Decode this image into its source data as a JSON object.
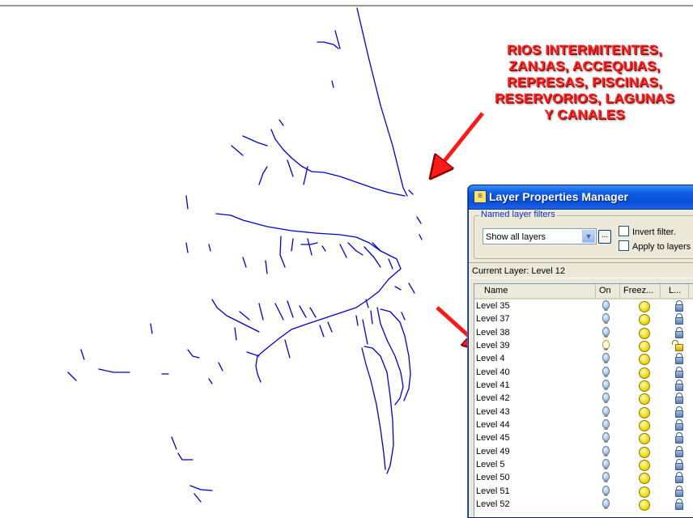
{
  "annotation": {
    "text": "RIOS INTERMITENTES,\nZANJAS, ACCEQUIAS,\nREPRESAS, PISCINAS,\nRESERVORIOS, LAGUNAS\nY CANALES",
    "color": "#ff2020"
  },
  "drawing_line_color": "#0000cc",
  "window": {
    "title": "Layer Properties Manager",
    "icon": "layer-manager-icon",
    "named_filters": {
      "legend": "Named layer filters",
      "selected": "Show all layers"
    },
    "invert_filter_label": "Invert filter.",
    "apply_label": "Apply to layers to",
    "current_layer_label": "Current Layer:",
    "current_layer_value": "Level 12",
    "columns": [
      "Name",
      "On",
      "Freez...",
      "L..."
    ],
    "layers": [
      {
        "name": "Level 35",
        "on": true,
        "frozen": false,
        "locked": true
      },
      {
        "name": "Level 37",
        "on": true,
        "frozen": false,
        "locked": true
      },
      {
        "name": "Level 38",
        "on": true,
        "frozen": false,
        "locked": true
      },
      {
        "name": "Level 39",
        "on": false,
        "frozen": false,
        "locked": false
      },
      {
        "name": "Level 4",
        "on": true,
        "frozen": false,
        "locked": true
      },
      {
        "name": "Level 40",
        "on": true,
        "frozen": false,
        "locked": true
      },
      {
        "name": "Level 41",
        "on": true,
        "frozen": false,
        "locked": true
      },
      {
        "name": "Level 42",
        "on": true,
        "frozen": false,
        "locked": true
      },
      {
        "name": "Level 43",
        "on": true,
        "frozen": false,
        "locked": true
      },
      {
        "name": "Level 44",
        "on": true,
        "frozen": false,
        "locked": true
      },
      {
        "name": "Level 45",
        "on": true,
        "frozen": false,
        "locked": true
      },
      {
        "name": "Level 49",
        "on": true,
        "frozen": false,
        "locked": true
      },
      {
        "name": "Level 5",
        "on": true,
        "frozen": false,
        "locked": true
      },
      {
        "name": "Level 50",
        "on": true,
        "frozen": false,
        "locked": true
      },
      {
        "name": "Level 51",
        "on": true,
        "frozen": false,
        "locked": true
      },
      {
        "name": "Level 52",
        "on": true,
        "frozen": false,
        "locked": true
      }
    ]
  }
}
